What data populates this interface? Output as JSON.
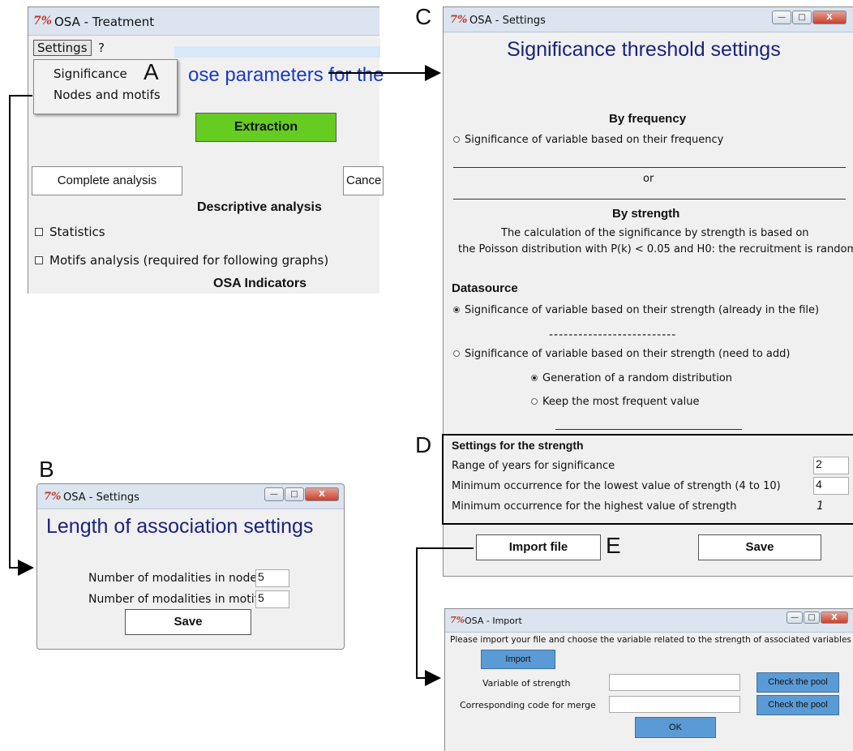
{
  "labels": {
    "A": "A",
    "B": "B",
    "C": "C",
    "D": "D",
    "E": "E"
  },
  "treatment": {
    "title": "OSA - Treatment",
    "menu": {
      "settings": "Settings",
      "help": "?"
    },
    "dropdown": [
      "Significance",
      "Nodes and motifs"
    ],
    "heading_partial": "ose parameters for the",
    "extraction": "Extraction",
    "complete": "Complete analysis",
    "cancel_partial": "Cance",
    "descriptive": "Descriptive analysis",
    "statistics": "Statistics",
    "motifs": "Motifs analysis (required for following graphs)",
    "indicators": "OSA Indicators",
    "accent": "#66cc22"
  },
  "length": {
    "title": "OSA - Settings",
    "heading": "Length of association settings",
    "nodes_label": "Number of modalities in nodes",
    "nodes_value": "5",
    "motifs_label": "Number of modalities in motifs",
    "motifs_value": "5",
    "save": "Save",
    "heading_color": "#1a237e"
  },
  "sig": {
    "title": "OSA - Settings",
    "heading": "Significance threshold settings",
    "by_freq": "By frequency",
    "freq_option": "Significance of variable based on their frequency",
    "or": "or",
    "by_strength": "By strength",
    "calc1": "The calculation of the significance by strength is based on",
    "calc2": "the Poisson distribution with P(k) < 0.05 and H0: the recruitment is random",
    "datasource": "Datasource",
    "already": "Significance of variable based on their strength (already in the file)",
    "dashes": "--------------------------",
    "need": "Significance of variable based on their strength (need to add)",
    "random": "Generation of a random distribution",
    "frequent": "Keep the most frequent value",
    "strength_title": "Settings for the strength",
    "range_label": "Range of years for significance",
    "range_value": "2",
    "min_low_label": "Minimum occurrence for the lowest value of strength (4 to 10)",
    "min_low_value": "4",
    "min_high_label": "Minimum occurrence for the highest value of strength",
    "min_high_value": "1",
    "import_btn": "Import file",
    "save": "Save"
  },
  "imp": {
    "title": "OSA - Import",
    "instruction": "Please import your file and choose the variable related to the strength of associated variables",
    "import_btn": "Import",
    "var_label": "Variable of strength",
    "code_label": "Corresponding code for merge",
    "check1": "Check the pool",
    "check2": "Check the pool",
    "ok": "OK",
    "button_color": "#5b9bd5"
  }
}
